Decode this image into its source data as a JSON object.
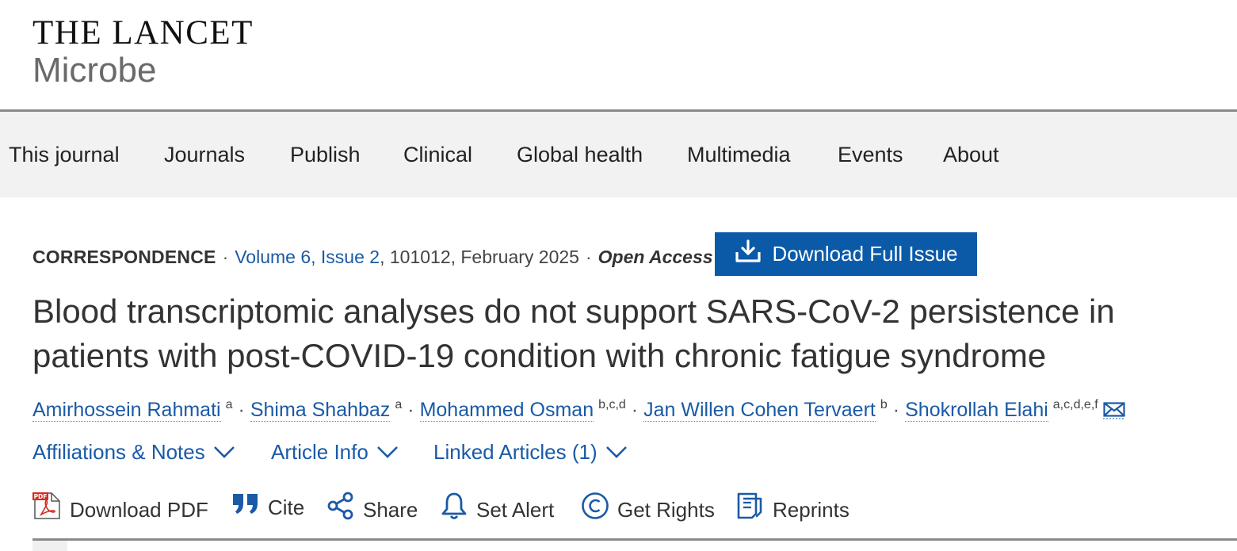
{
  "brand": {
    "name": "THE LANCET",
    "subtitle": "Microbe"
  },
  "nav": {
    "items": [
      "This journal",
      "Journals",
      "Publish",
      "Clinical",
      "Global health",
      "Multimedia",
      "Events",
      "About"
    ]
  },
  "meta": {
    "type": "CORRESPONDENCE",
    "separator": "·",
    "volume_issue": "Volume 6, Issue 2",
    "details": ", 101012, February 2025",
    "access": "Open Access"
  },
  "download_issue": {
    "label": "Download Full Issue",
    "icon": "download-icon",
    "color": "#0a5aa8"
  },
  "article": {
    "title": "Blood transcriptomic analyses do not support SARS-CoV-2 persistence in patients with post-COVID-19 condition with chronic fatigue syndrome"
  },
  "authors": [
    {
      "name": "Amirhossein Rahmati",
      "affil": "a"
    },
    {
      "name": "Shima Shahbaz",
      "affil": "a"
    },
    {
      "name": "Mohammed Osman",
      "affil": "b,c,d"
    },
    {
      "name": "Jan Willen Cohen Tervaert",
      "affil": "b"
    },
    {
      "name": "Shokrollah Elahi",
      "affil": "a,c,d,e,f"
    }
  ],
  "expanders": {
    "affiliations": "Affiliations & Notes",
    "article_info": "Article Info",
    "linked": "Linked Articles (1)"
  },
  "toolbar": {
    "download_pdf": "Download PDF",
    "pdf_badge": "PDF",
    "cite": "Cite",
    "share": "Share",
    "set_alert": "Set Alert",
    "get_rights": "Get Rights",
    "reprints": "Reprints"
  },
  "colors": {
    "link": "#1a5aa6",
    "nav_bg": "#f2f2f2",
    "button": "#0a5aa8"
  }
}
